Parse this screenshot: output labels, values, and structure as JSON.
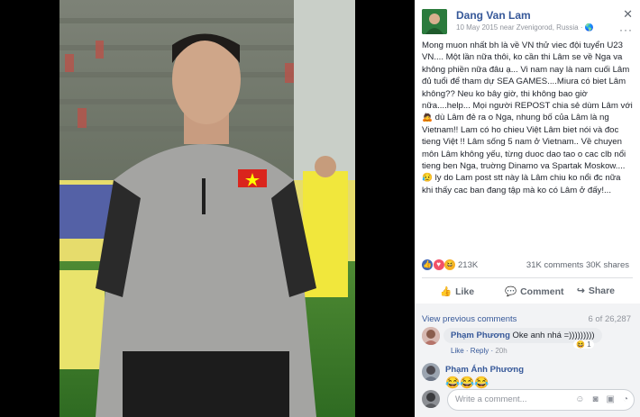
{
  "post": {
    "author": "Dang Van Lam",
    "meta": "10 May 2015 near Zvenigorod, Russia · 🌎",
    "close": "✕",
    "more": "···",
    "text": "Mong muon nhất bh là về VN thử viec đội tuyển U23 VN.... Một lần nữa thôi, ko cần thi Lâm se về Nga va không phiền nữa đâu ạ... Vi nam nay là nam cuối Lâm đủ tuổi để tham dự SEA GAMES....Miura có biet Lâm không?? Neu ko bây giờ, thi không bao giờ nữa....help... Mọi người REPOST chia sẻ dùm Lâm với 🙇 dù Lâm đẻ ra o Nga, nhung bố của Lâm là ng Vietnam!! Lam có ho chieu Việt Lâm biet nói và đoc tieng Việt !! Lâm sống 5 nam ở Vietnam.. Về chuyen môn Lâm không yếu, từng duoc dao tao o cac clb nổi tieng ben Nga, truờng Dinamo va Spartak Moskow....😥 ly do Lam post stt này là Lâm chiu ko nổi đc nữa khi thấy cac ban đang tập mà ko có Lâm ở đấy!..."
  },
  "stats": {
    "reaction_count": "213K",
    "comments": "31K comments",
    "shares": "30K shares",
    "colors": {
      "like": "#4267b2",
      "love": "#f25268",
      "haha": "#f7b125"
    }
  },
  "actions": {
    "like": "Like",
    "comment": "Comment",
    "share": "Share"
  },
  "comments": {
    "view_previous": "View previous comments",
    "count": "6 of 26,287",
    "items": [
      {
        "name": "Phạm Phương",
        "text": "Oke anh nhá =)))))))))",
        "reactions": "😆 1",
        "like": "Like",
        "reply": "Reply",
        "time": "20h"
      },
      {
        "name": "Phạm Ánh Phương",
        "emoji": "😂😂😂"
      }
    ],
    "input_placeholder": "Write a comment..."
  }
}
